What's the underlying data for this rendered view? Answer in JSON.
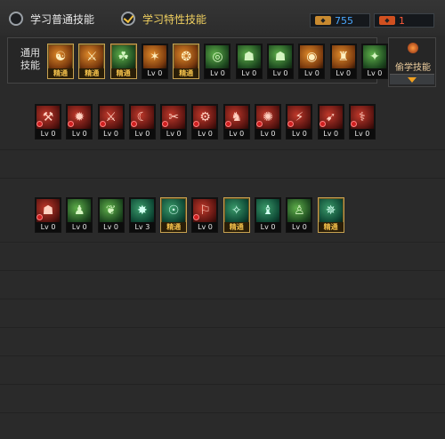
{
  "tabs": [
    {
      "label": "学习普通技能",
      "active": false
    },
    {
      "label": "学习特性技能",
      "active": true
    }
  ],
  "currency": {
    "blue": {
      "icon": "token-icon",
      "value": "755"
    },
    "red": {
      "icon": "token-icon",
      "value": "1"
    }
  },
  "common_panel": {
    "label": "通用技能",
    "skills": [
      {
        "tag": "精通",
        "mastered": true,
        "color": "o",
        "glyph": "☯"
      },
      {
        "tag": "精通",
        "mastered": true,
        "color": "o",
        "glyph": "⚔"
      },
      {
        "tag": "精通",
        "mastered": true,
        "color": "g",
        "glyph": "☘"
      },
      {
        "tag": "Lv 0",
        "mastered": false,
        "color": "o",
        "glyph": "✶"
      },
      {
        "tag": "精通",
        "mastered": true,
        "color": "o",
        "glyph": "❂"
      },
      {
        "tag": "Lv 0",
        "mastered": false,
        "color": "g",
        "glyph": "◎"
      },
      {
        "tag": "Lv 0",
        "mastered": false,
        "color": "g",
        "glyph": "☗"
      },
      {
        "tag": "Lv 0",
        "mastered": false,
        "color": "g",
        "glyph": "☗"
      },
      {
        "tag": "Lv 0",
        "mastered": false,
        "color": "o",
        "glyph": "◉"
      },
      {
        "tag": "Lv 0",
        "mastered": false,
        "color": "o",
        "glyph": "♜"
      },
      {
        "tag": "Lv 0",
        "mastered": false,
        "color": "g",
        "glyph": "✦"
      }
    ]
  },
  "steal_panel": {
    "label": "偷学技能"
  },
  "row2": [
    {
      "tag": "Lv 0",
      "mastered": false,
      "color": "r",
      "glyph": "⚒"
    },
    {
      "tag": "Lv 0",
      "mastered": false,
      "color": "r",
      "glyph": "✹"
    },
    {
      "tag": "Lv 0",
      "mastered": false,
      "color": "r",
      "glyph": "⚔"
    },
    {
      "tag": "Lv 0",
      "mastered": false,
      "color": "r",
      "glyph": "☾"
    },
    {
      "tag": "Lv 0",
      "mastered": false,
      "color": "r",
      "glyph": "✂"
    },
    {
      "tag": "Lv 0",
      "mastered": false,
      "color": "r",
      "glyph": "⚙"
    },
    {
      "tag": "Lv 0",
      "mastered": false,
      "color": "r",
      "glyph": "♞"
    },
    {
      "tag": "Lv 0",
      "mastered": false,
      "color": "r",
      "glyph": "✺"
    },
    {
      "tag": "Lv 0",
      "mastered": false,
      "color": "r",
      "glyph": "⚡"
    },
    {
      "tag": "Lv 0",
      "mastered": false,
      "color": "r",
      "glyph": "➹"
    },
    {
      "tag": "Lv 0",
      "mastered": false,
      "color": "r",
      "glyph": "⚕"
    }
  ],
  "row3": [
    {
      "tag": "Lv 0",
      "mastered": false,
      "color": "r",
      "glyph": "☗"
    },
    {
      "tag": "Lv 0",
      "mastered": false,
      "color": "g",
      "glyph": "♟"
    },
    {
      "tag": "Lv 0",
      "mastered": false,
      "color": "g",
      "glyph": "❦"
    },
    {
      "tag": "Lv 3",
      "mastered": false,
      "color": "t",
      "glyph": "✸"
    },
    {
      "tag": "精通",
      "mastered": true,
      "color": "t",
      "glyph": "☉"
    },
    {
      "tag": "Lv 0",
      "mastered": false,
      "color": "r",
      "glyph": "⚐"
    },
    {
      "tag": "精通",
      "mastered": true,
      "color": "t",
      "glyph": "✧"
    },
    {
      "tag": "Lv 0",
      "mastered": false,
      "color": "t",
      "glyph": "♝"
    },
    {
      "tag": "Lv 0",
      "mastered": false,
      "color": "g",
      "glyph": "♙"
    },
    {
      "tag": "精通",
      "mastered": true,
      "color": "t",
      "glyph": "✵"
    }
  ]
}
